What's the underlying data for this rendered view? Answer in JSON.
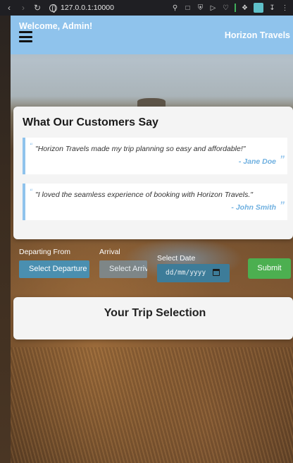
{
  "browser": {
    "url": "127.0.0.1:10000"
  },
  "header": {
    "welcome": "Welcome, Admin!",
    "brand": "Horizon Travels"
  },
  "testimonials": {
    "title": "What Our Customers Say",
    "items": [
      {
        "quote": "\"Horizon Travels made my trip planning so easy and affordable!\"",
        "author": "- Jane Doe"
      },
      {
        "quote": "\"I loved the seamless experience of booking with Horizon Travels.\"",
        "author": "- John Smith"
      }
    ]
  },
  "booking": {
    "departing_label": "Departing From",
    "departing_value": "Select Departure",
    "arrival_label": "Arrival",
    "arrival_value": "Select Arrival",
    "date_label": "Select Date",
    "date_placeholder": "dd/mm/yyyy",
    "submit_label": "Submit"
  },
  "trip": {
    "title": "Your Trip Selection"
  },
  "colors": {
    "header": "#8fc3ec",
    "submit": "#4caf50",
    "select": "#4a8fb0"
  }
}
